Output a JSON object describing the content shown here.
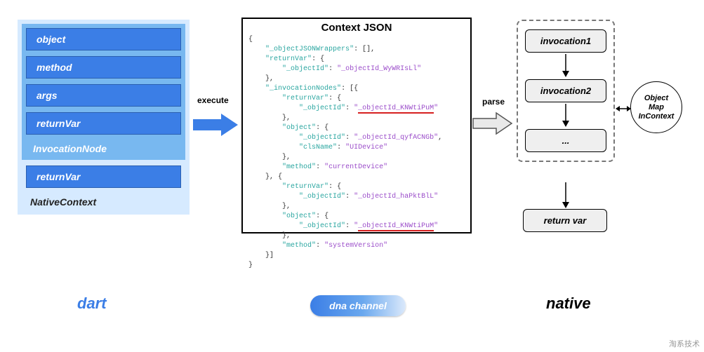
{
  "dart": {
    "items": [
      "object",
      "method",
      "args",
      "returnVar"
    ],
    "inv_label": "InvocationNode",
    "outer_item": "returnVar",
    "ctx_label": "NativeContext",
    "footer": "dart"
  },
  "arrows": {
    "execute": "execute",
    "parse": "parse"
  },
  "json_panel": {
    "title": "Context JSON",
    "keys": {
      "wrappers": "_objectJSONWrappers",
      "returnVar": "returnVar",
      "objectId": "_objectId",
      "invocationNodes": "_invocationNodes",
      "object": "object",
      "clsName": "clsName",
      "method": "method"
    },
    "vals": {
      "id_return": "_objectId_WyWRIsLl",
      "id_red": "_objectId_KNWtiPuM",
      "id_obj1": "_objectId_qyfACNGb",
      "cls1": "UIDevice",
      "method1": "currentDevice",
      "id_ret2": "_objectId_haPktBlL",
      "method2": "systemVersion"
    }
  },
  "native": {
    "nodes": [
      "invocation1",
      "invocation2",
      "..."
    ],
    "return": "return var",
    "obj_map": "Object\nMap\nInContext",
    "footer": "native"
  },
  "channel": "dna channel",
  "watermark": "淘系技术"
}
